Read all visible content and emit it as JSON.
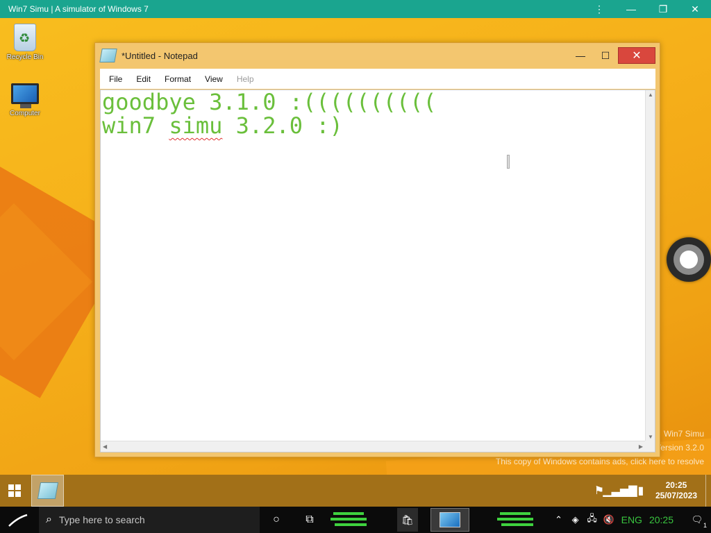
{
  "host": {
    "title": "Win7 Simu | A simulator of Windows 7",
    "menu_icon": "kebab-menu-icon",
    "minimize_icon": "minimize-icon",
    "restore_icon": "restore-icon",
    "close_icon": "close-icon"
  },
  "desktop": {
    "icons": [
      {
        "label": "Recycle Bin",
        "icon": "recycle-bin-icon"
      },
      {
        "label": "Computer",
        "icon": "computer-icon"
      }
    ],
    "watermark": {
      "line1": "Win7 Simu",
      "line2": "Version 3.2.0",
      "line3": "This copy of Windows contains ads, click here to resolve"
    }
  },
  "notepad": {
    "title": "*Untitled - Notepad",
    "menu": [
      "File",
      "Edit",
      "Format",
      "View",
      "Help"
    ],
    "lines": [
      "goodbye 3.1.0 :((((((((((",
      "win7 ",
      "simu",
      " 3.2.0 :)"
    ],
    "text_color": "#6abf3b"
  },
  "taskbar_top": {
    "clock_time": "20:25",
    "clock_date": "25/07/2023",
    "tray_icons": [
      "flag-icon",
      "signal-icon",
      "battery-icon"
    ]
  },
  "taskbar_bottom": {
    "search_placeholder": "Type here to search",
    "language": "ENG",
    "time": "20:25",
    "notification_count": "1",
    "accent": "#3fd23f"
  }
}
